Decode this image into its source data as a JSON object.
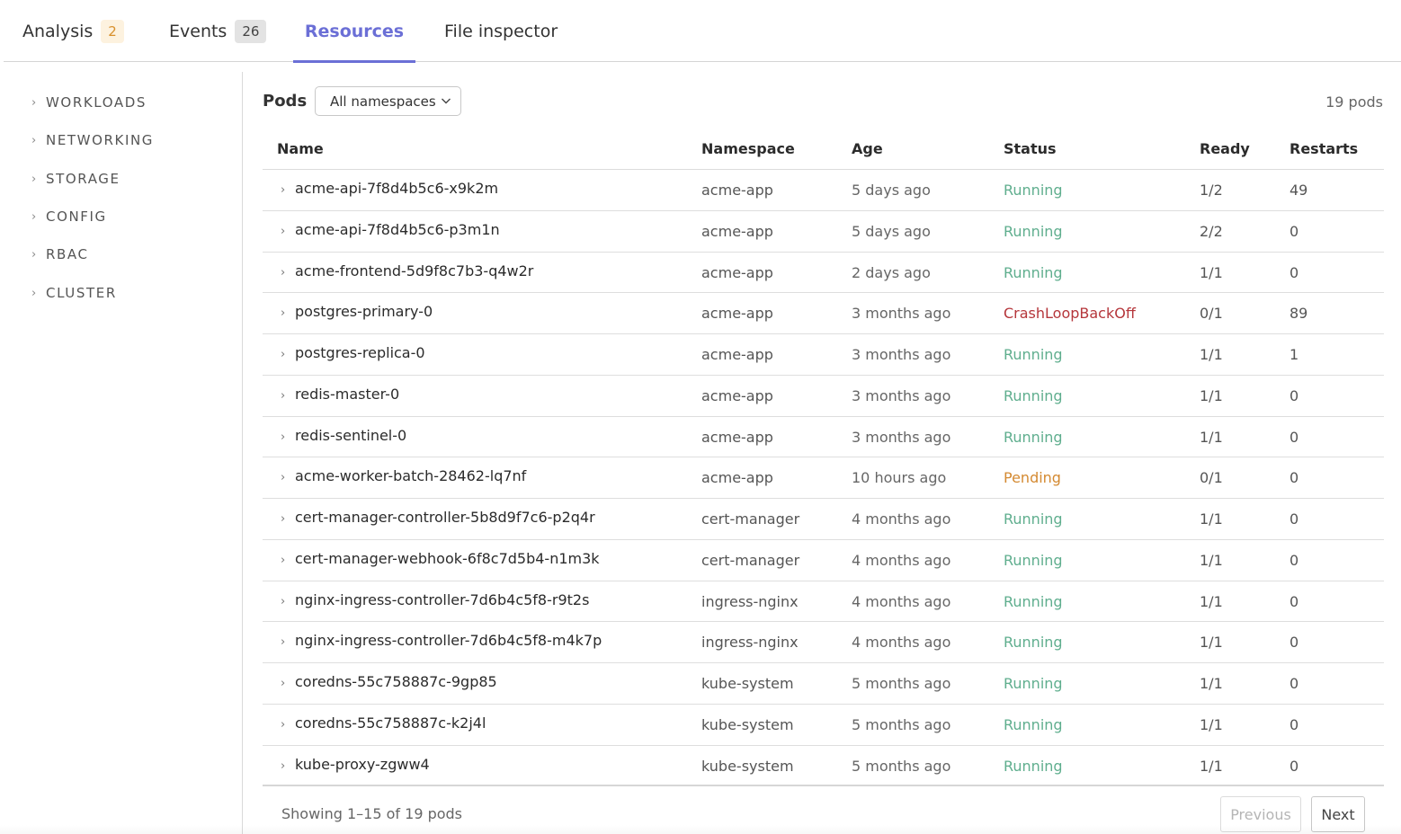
{
  "tabs": [
    {
      "label": "Analysis",
      "badge": "2",
      "badge_color": "#d8902c"
    },
    {
      "label": "Events",
      "badge": "26"
    },
    {
      "label": "Resources",
      "active": true
    },
    {
      "label": "File inspector"
    }
  ],
  "sidebar": {
    "items": [
      {
        "label": "WORKLOADS"
      },
      {
        "label": "NETWORKING"
      },
      {
        "label": "STORAGE"
      },
      {
        "label": "CONFIG"
      },
      {
        "label": "RBAC"
      },
      {
        "label": "CLUSTER"
      }
    ]
  },
  "pods": {
    "title": "Pods",
    "namespace_select": "All namespaces",
    "count_label": "19 pods",
    "columns": [
      "Name",
      "Namespace",
      "Age",
      "Status",
      "Ready",
      "Restarts"
    ],
    "rows": [
      {
        "name": "acme-api-7f8d4b5c6-x9k2m",
        "namespace": "acme-app",
        "age": "5 days ago",
        "status": "Running",
        "ready": "1/2",
        "restarts": "49"
      },
      {
        "name": "acme-api-7f8d4b5c6-p3m1n",
        "namespace": "acme-app",
        "age": "5 days ago",
        "status": "Running",
        "ready": "2/2",
        "restarts": "0"
      },
      {
        "name": "acme-frontend-5d9f8c7b3-q4w2r",
        "namespace": "acme-app",
        "age": "2 days ago",
        "status": "Running",
        "ready": "1/1",
        "restarts": "0"
      },
      {
        "name": "postgres-primary-0",
        "namespace": "acme-app",
        "age": "3 months ago",
        "status": "CrashLoopBackOff",
        "ready": "0/1",
        "restarts": "89"
      },
      {
        "name": "postgres-replica-0",
        "namespace": "acme-app",
        "age": "3 months ago",
        "status": "Running",
        "ready": "1/1",
        "restarts": "1"
      },
      {
        "name": "redis-master-0",
        "namespace": "acme-app",
        "age": "3 months ago",
        "status": "Running",
        "ready": "1/1",
        "restarts": "0"
      },
      {
        "name": "redis-sentinel-0",
        "namespace": "acme-app",
        "age": "3 months ago",
        "status": "Running",
        "ready": "1/1",
        "restarts": "0"
      },
      {
        "name": "acme-worker-batch-28462-lq7nf",
        "namespace": "acme-app",
        "age": "10 hours ago",
        "status": "Pending",
        "ready": "0/1",
        "restarts": "0"
      },
      {
        "name": "cert-manager-controller-5b8d9f7c6-p2q4r",
        "namespace": "cert-manager",
        "age": "4 months ago",
        "status": "Running",
        "ready": "1/1",
        "restarts": "0"
      },
      {
        "name": "cert-manager-webhook-6f8c7d5b4-n1m3k",
        "namespace": "cert-manager",
        "age": "4 months ago",
        "status": "Running",
        "ready": "1/1",
        "restarts": "0"
      },
      {
        "name": "nginx-ingress-controller-7d6b4c5f8-r9t2s",
        "namespace": "ingress-nginx",
        "age": "4 months ago",
        "status": "Running",
        "ready": "1/1",
        "restarts": "0"
      },
      {
        "name": "nginx-ingress-controller-7d6b4c5f8-m4k7p",
        "namespace": "ingress-nginx",
        "age": "4 months ago",
        "status": "Running",
        "ready": "1/1",
        "restarts": "0"
      },
      {
        "name": "coredns-55c758887c-9gp85",
        "namespace": "kube-system",
        "age": "5 months ago",
        "status": "Running",
        "ready": "1/1",
        "restarts": "0"
      },
      {
        "name": "coredns-55c758887c-k2j4l",
        "namespace": "kube-system",
        "age": "5 months ago",
        "status": "Running",
        "ready": "1/1",
        "restarts": "0"
      },
      {
        "name": "kube-proxy-zgww4",
        "namespace": "kube-system",
        "age": "5 months ago",
        "status": "Running",
        "ready": "1/1",
        "restarts": "0"
      }
    ]
  },
  "status_colors": {
    "Running": "#5fae8e",
    "CrashLoopBackOff": "#b5363b",
    "Pending": "#d48a32"
  },
  "pagination": {
    "summary": "Showing 1–15 of 19 pods",
    "previous_label": "Previous",
    "next_label": "Next"
  }
}
